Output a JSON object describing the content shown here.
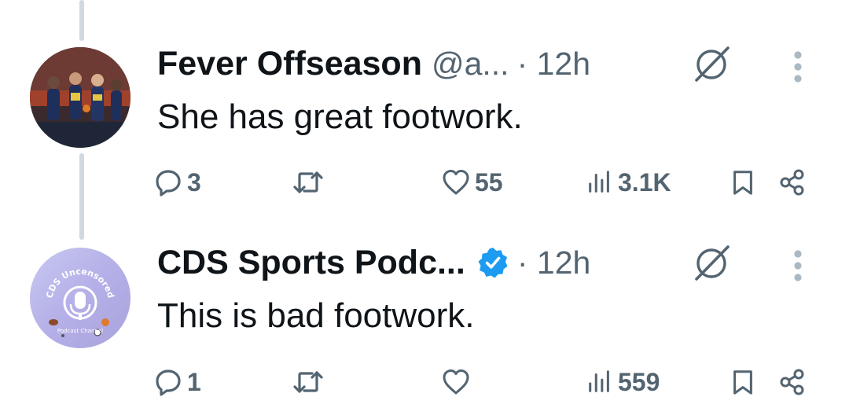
{
  "tweets": [
    {
      "display_name": "Fever Offseason",
      "handle": "@a...",
      "time": "· 12h",
      "text": "She has great footwork.",
      "verified": false,
      "replies": "3",
      "retweets": "",
      "likes": "55",
      "views": "3.1K"
    },
    {
      "display_name": "CDS Sports Podc...",
      "handle": "",
      "time": "· 12h",
      "text": "This is bad footwork.",
      "verified": true,
      "replies": "1",
      "retweets": "",
      "likes": "",
      "views": "559"
    }
  ],
  "avatar2_text": {
    "arc": "CDS Uncensored",
    "sub": "Podcast Channel"
  },
  "colors": {
    "text_primary": "#0f1419",
    "text_secondary": "#536471",
    "thread_line": "#cfd9de",
    "verified_blue": "#1d9bf0"
  },
  "icons": {
    "reply": "reply-icon",
    "retweet": "retweet-icon",
    "like": "heart-icon",
    "views": "views-icon",
    "bookmark": "bookmark-icon",
    "share": "share-icon",
    "grok": "grok-icon",
    "more": "more-icon",
    "verified": "verified-badge-icon"
  }
}
